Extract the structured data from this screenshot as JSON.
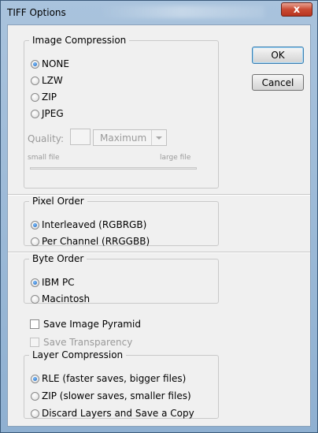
{
  "window": {
    "title": "TIFF Options",
    "close_glyph": "x"
  },
  "buttons": {
    "ok": "OK",
    "cancel": "Cancel"
  },
  "image_compression": {
    "legend": "Image Compression",
    "options": [
      "NONE",
      "LZW",
      "ZIP",
      "JPEG"
    ],
    "selected": "NONE",
    "quality_label": "Quality:",
    "quality_value": "",
    "quality_select": "Maximum",
    "small_file": "small file",
    "large_file": "large file"
  },
  "pixel_order": {
    "legend": "Pixel Order",
    "options": [
      "Interleaved (RGBRGB)",
      "Per Channel (RRGGBB)"
    ],
    "selected": "Interleaved (RGBRGB)"
  },
  "byte_order": {
    "legend": "Byte Order",
    "options": [
      "IBM PC",
      "Macintosh"
    ],
    "selected": "IBM PC"
  },
  "checkboxes": {
    "save_image_pyramid": "Save Image Pyramid",
    "save_transparency": "Save Transparency"
  },
  "layer_compression": {
    "legend": "Layer Compression",
    "options": [
      "RLE (faster saves, bigger files)",
      "ZIP (slower saves, smaller files)",
      "Discard Layers and Save a Copy"
    ],
    "selected": "RLE (faster saves, bigger files)"
  },
  "colors": {
    "frame": "#a9c3dd",
    "close_button": "#c94a33",
    "radio_dot": "#1a5fb4",
    "dialog_bg": "#f0f0f0"
  }
}
